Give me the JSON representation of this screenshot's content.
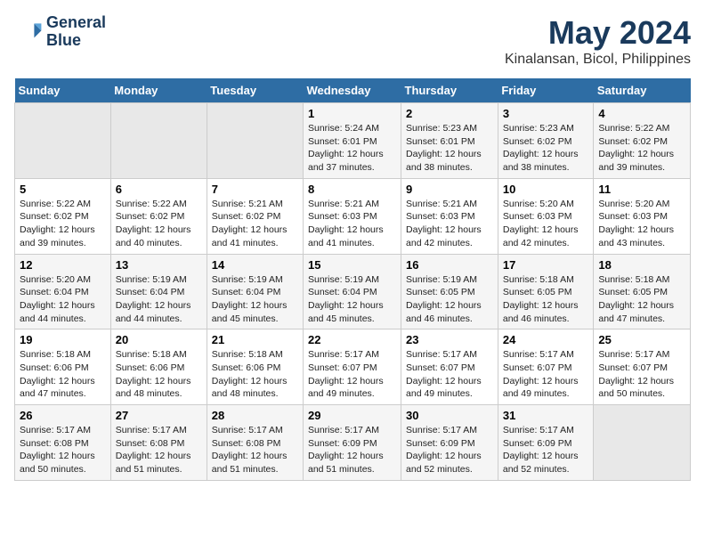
{
  "logo": {
    "line1": "General",
    "line2": "Blue"
  },
  "title": "May 2024",
  "subtitle": "Kinalansan, Bicol, Philippines",
  "days_of_week": [
    "Sunday",
    "Monday",
    "Tuesday",
    "Wednesday",
    "Thursday",
    "Friday",
    "Saturday"
  ],
  "weeks": [
    [
      {
        "num": "",
        "sunrise": "",
        "sunset": "",
        "daylight": ""
      },
      {
        "num": "",
        "sunrise": "",
        "sunset": "",
        "daylight": ""
      },
      {
        "num": "",
        "sunrise": "",
        "sunset": "",
        "daylight": ""
      },
      {
        "num": "1",
        "sunrise": "Sunrise: 5:24 AM",
        "sunset": "Sunset: 6:01 PM",
        "daylight": "Daylight: 12 hours and 37 minutes."
      },
      {
        "num": "2",
        "sunrise": "Sunrise: 5:23 AM",
        "sunset": "Sunset: 6:01 PM",
        "daylight": "Daylight: 12 hours and 38 minutes."
      },
      {
        "num": "3",
        "sunrise": "Sunrise: 5:23 AM",
        "sunset": "Sunset: 6:02 PM",
        "daylight": "Daylight: 12 hours and 38 minutes."
      },
      {
        "num": "4",
        "sunrise": "Sunrise: 5:22 AM",
        "sunset": "Sunset: 6:02 PM",
        "daylight": "Daylight: 12 hours and 39 minutes."
      }
    ],
    [
      {
        "num": "5",
        "sunrise": "Sunrise: 5:22 AM",
        "sunset": "Sunset: 6:02 PM",
        "daylight": "Daylight: 12 hours and 39 minutes."
      },
      {
        "num": "6",
        "sunrise": "Sunrise: 5:22 AM",
        "sunset": "Sunset: 6:02 PM",
        "daylight": "Daylight: 12 hours and 40 minutes."
      },
      {
        "num": "7",
        "sunrise": "Sunrise: 5:21 AM",
        "sunset": "Sunset: 6:02 PM",
        "daylight": "Daylight: 12 hours and 41 minutes."
      },
      {
        "num": "8",
        "sunrise": "Sunrise: 5:21 AM",
        "sunset": "Sunset: 6:03 PM",
        "daylight": "Daylight: 12 hours and 41 minutes."
      },
      {
        "num": "9",
        "sunrise": "Sunrise: 5:21 AM",
        "sunset": "Sunset: 6:03 PM",
        "daylight": "Daylight: 12 hours and 42 minutes."
      },
      {
        "num": "10",
        "sunrise": "Sunrise: 5:20 AM",
        "sunset": "Sunset: 6:03 PM",
        "daylight": "Daylight: 12 hours and 42 minutes."
      },
      {
        "num": "11",
        "sunrise": "Sunrise: 5:20 AM",
        "sunset": "Sunset: 6:03 PM",
        "daylight": "Daylight: 12 hours and 43 minutes."
      }
    ],
    [
      {
        "num": "12",
        "sunrise": "Sunrise: 5:20 AM",
        "sunset": "Sunset: 6:04 PM",
        "daylight": "Daylight: 12 hours and 44 minutes."
      },
      {
        "num": "13",
        "sunrise": "Sunrise: 5:19 AM",
        "sunset": "Sunset: 6:04 PM",
        "daylight": "Daylight: 12 hours and 44 minutes."
      },
      {
        "num": "14",
        "sunrise": "Sunrise: 5:19 AM",
        "sunset": "Sunset: 6:04 PM",
        "daylight": "Daylight: 12 hours and 45 minutes."
      },
      {
        "num": "15",
        "sunrise": "Sunrise: 5:19 AM",
        "sunset": "Sunset: 6:04 PM",
        "daylight": "Daylight: 12 hours and 45 minutes."
      },
      {
        "num": "16",
        "sunrise": "Sunrise: 5:19 AM",
        "sunset": "Sunset: 6:05 PM",
        "daylight": "Daylight: 12 hours and 46 minutes."
      },
      {
        "num": "17",
        "sunrise": "Sunrise: 5:18 AM",
        "sunset": "Sunset: 6:05 PM",
        "daylight": "Daylight: 12 hours and 46 minutes."
      },
      {
        "num": "18",
        "sunrise": "Sunrise: 5:18 AM",
        "sunset": "Sunset: 6:05 PM",
        "daylight": "Daylight: 12 hours and 47 minutes."
      }
    ],
    [
      {
        "num": "19",
        "sunrise": "Sunrise: 5:18 AM",
        "sunset": "Sunset: 6:06 PM",
        "daylight": "Daylight: 12 hours and 47 minutes."
      },
      {
        "num": "20",
        "sunrise": "Sunrise: 5:18 AM",
        "sunset": "Sunset: 6:06 PM",
        "daylight": "Daylight: 12 hours and 48 minutes."
      },
      {
        "num": "21",
        "sunrise": "Sunrise: 5:18 AM",
        "sunset": "Sunset: 6:06 PM",
        "daylight": "Daylight: 12 hours and 48 minutes."
      },
      {
        "num": "22",
        "sunrise": "Sunrise: 5:17 AM",
        "sunset": "Sunset: 6:07 PM",
        "daylight": "Daylight: 12 hours and 49 minutes."
      },
      {
        "num": "23",
        "sunrise": "Sunrise: 5:17 AM",
        "sunset": "Sunset: 6:07 PM",
        "daylight": "Daylight: 12 hours and 49 minutes."
      },
      {
        "num": "24",
        "sunrise": "Sunrise: 5:17 AM",
        "sunset": "Sunset: 6:07 PM",
        "daylight": "Daylight: 12 hours and 49 minutes."
      },
      {
        "num": "25",
        "sunrise": "Sunrise: 5:17 AM",
        "sunset": "Sunset: 6:07 PM",
        "daylight": "Daylight: 12 hours and 50 minutes."
      }
    ],
    [
      {
        "num": "26",
        "sunrise": "Sunrise: 5:17 AM",
        "sunset": "Sunset: 6:08 PM",
        "daylight": "Daylight: 12 hours and 50 minutes."
      },
      {
        "num": "27",
        "sunrise": "Sunrise: 5:17 AM",
        "sunset": "Sunset: 6:08 PM",
        "daylight": "Daylight: 12 hours and 51 minutes."
      },
      {
        "num": "28",
        "sunrise": "Sunrise: 5:17 AM",
        "sunset": "Sunset: 6:08 PM",
        "daylight": "Daylight: 12 hours and 51 minutes."
      },
      {
        "num": "29",
        "sunrise": "Sunrise: 5:17 AM",
        "sunset": "Sunset: 6:09 PM",
        "daylight": "Daylight: 12 hours and 51 minutes."
      },
      {
        "num": "30",
        "sunrise": "Sunrise: 5:17 AM",
        "sunset": "Sunset: 6:09 PM",
        "daylight": "Daylight: 12 hours and 52 minutes."
      },
      {
        "num": "31",
        "sunrise": "Sunrise: 5:17 AM",
        "sunset": "Sunset: 6:09 PM",
        "daylight": "Daylight: 12 hours and 52 minutes."
      },
      {
        "num": "",
        "sunrise": "",
        "sunset": "",
        "daylight": ""
      }
    ]
  ]
}
